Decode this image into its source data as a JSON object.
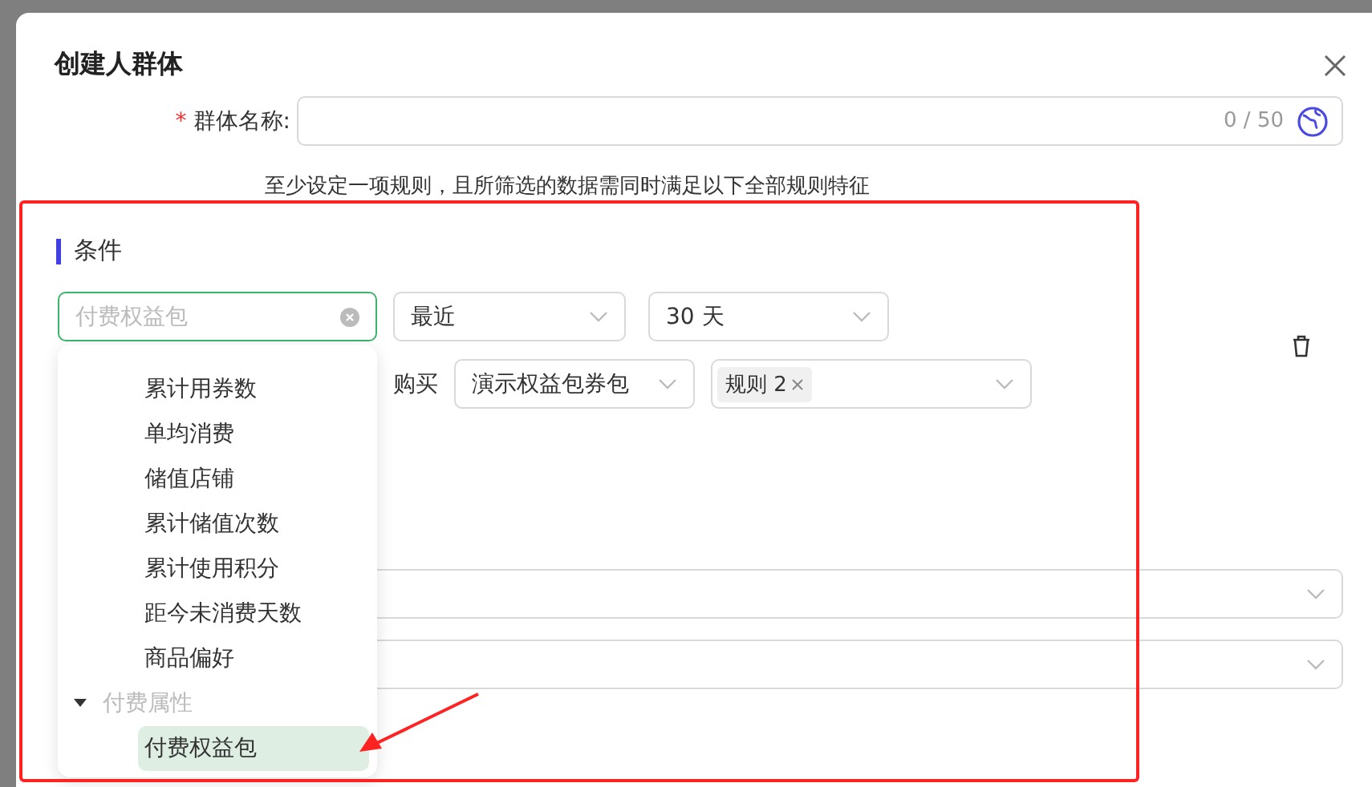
{
  "dialog": {
    "title": "创建人群体"
  },
  "name_field": {
    "label": "群体名称:",
    "required_mark": "*",
    "counter": "0 / 50"
  },
  "hint": "至少设定一项规则，且所筛选的数据需同时满足以下全部规则特征",
  "section": {
    "title": "条件"
  },
  "condition_row": {
    "attribute": {
      "placeholder": "付费权益包",
      "focused": true
    },
    "period": {
      "value": "最近"
    },
    "range": {
      "value": "30 天"
    }
  },
  "action_row": {
    "verb": "购买",
    "package": {
      "value": "演示权益包券包"
    },
    "rules": {
      "tags": [
        "规则 2"
      ]
    }
  },
  "dropdown": {
    "items": [
      {
        "kind": "leaf",
        "label": "累计用券数",
        "selected": false
      },
      {
        "kind": "leaf",
        "label": "单均消费",
        "selected": false
      },
      {
        "kind": "leaf",
        "label": "储值店铺",
        "selected": false
      },
      {
        "kind": "leaf",
        "label": "累计储值次数",
        "selected": false
      },
      {
        "kind": "leaf",
        "label": "累计使用积分",
        "selected": false
      },
      {
        "kind": "leaf",
        "label": "距今未消费天数",
        "selected": false
      },
      {
        "kind": "leaf",
        "label": "商品偏好",
        "selected": false
      },
      {
        "kind": "group",
        "label": "付费属性",
        "expanded": true,
        "children": [
          {
            "label": "付费权益包",
            "selected": true
          }
        ]
      }
    ]
  }
}
